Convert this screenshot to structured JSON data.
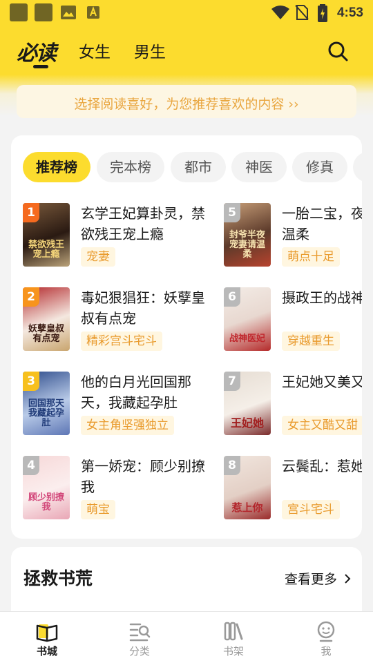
{
  "status_bar": {
    "time": "4:53"
  },
  "header": {
    "logo": "必读",
    "tabs": [
      "女生",
      "男生"
    ]
  },
  "banner": {
    "text": "选择阅读喜好，为您推荐喜欢的内容 ››"
  },
  "ranking": {
    "categories": [
      "推荐榜",
      "完本榜",
      "都市",
      "神医",
      "修真"
    ],
    "active_category": "推荐榜",
    "books": [
      {
        "rank": "1",
        "title": "玄学王妃算卦灵，禁欲残王宠上瘾",
        "tag": "宠妻",
        "cover_text": "禁欲残王宠上瘾"
      },
      {
        "rank": "2",
        "title": "毒妃狠猖狂：妖孽皇叔有点宠",
        "tag": "精彩宫斗宅斗",
        "cover_text": "妖孽皇叔有点宠"
      },
      {
        "rank": "3",
        "title": "他的白月光回国那天，我藏起孕肚",
        "tag": "女主角坚强独立",
        "cover_text": "回国那天我藏起孕肚"
      },
      {
        "rank": "4",
        "title": "第一娇宠：顾少别撩我",
        "tag": "萌宝",
        "cover_text": "顾少别撩我"
      },
      {
        "rank": "5",
        "title": "一胎二宝，夜宠妻请温柔",
        "tag": "萌点十足",
        "cover_text": "封爷半夜宠妻请温柔"
      },
      {
        "rank": "6",
        "title": "摄政王的战神医妃",
        "tag": "穿越重生",
        "cover_text": "战神医妃"
      },
      {
        "rank": "7",
        "title": "王妃她又美又飒",
        "tag": "女主又酷又甜",
        "cover_text": "王妃她"
      },
      {
        "rank": "8",
        "title": "云鬓乱：惹她逃不掉",
        "tag": "宫斗宅斗",
        "cover_text": "惹上你"
      }
    ]
  },
  "rescue": {
    "title": "拯救书荒",
    "more": "查看更多"
  },
  "bottom_nav": [
    {
      "label": "书城",
      "icon": "book-open-icon",
      "active": true
    },
    {
      "label": "分类",
      "icon": "category-search-icon",
      "active": false
    },
    {
      "label": "书架",
      "icon": "bookshelf-icon",
      "active": false
    },
    {
      "label": "我",
      "icon": "profile-icon",
      "active": false
    }
  ],
  "colors": {
    "brand_yellow": "#fcdc2e",
    "tag_text": "#e99b2e",
    "tag_bg": "#fff6e0",
    "banner_text": "#e9a63f"
  }
}
